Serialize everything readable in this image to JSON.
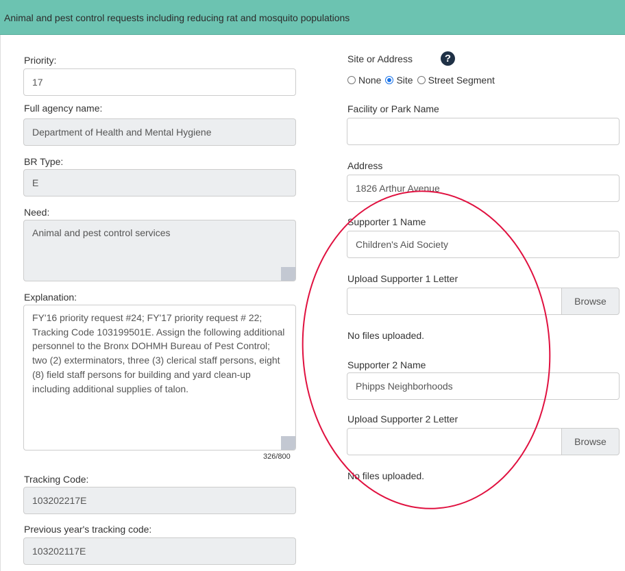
{
  "header": {
    "title": "Animal and pest control requests including reducing rat and mosquito populations"
  },
  "left": {
    "priority": {
      "label": "Priority:",
      "value": "17"
    },
    "agency": {
      "label": "Full agency name:",
      "value": "Department of Health and Mental Hygiene"
    },
    "br_type": {
      "label": "BR Type:",
      "value": "E"
    },
    "need": {
      "label": "Need:",
      "value": "Animal and pest control services"
    },
    "explanation": {
      "label": "Explanation:",
      "value": "FY'16 priority request #24; FY'17 priority request # 22; Tracking Code 103199501E.  Assign the following additional personnel to the Bronx DOHMH Bureau of Pest Control; two (2) exterminators, three (3) clerical staff persons, eight (8) field staff persons for building and yard clean-up including additional supplies of talon.",
      "counter": "326/800"
    },
    "tracking_code": {
      "label": "Tracking Code:",
      "value": "103202217E"
    },
    "prev_tracking": {
      "label": "Previous year's tracking code:",
      "value": "103202117E"
    }
  },
  "right": {
    "site_address": {
      "label": "Site or Address",
      "help_icon": "?",
      "options": [
        "None",
        "Site",
        "Street Segment"
      ],
      "selected": "Site"
    },
    "facility": {
      "label": "Facility or Park Name",
      "value": ""
    },
    "address": {
      "label": "Address",
      "value": "1826 Arthur Avenue"
    },
    "supporter1": {
      "label": "Supporter 1 Name",
      "value": "Children's Aid Society"
    },
    "upload1": {
      "label": "Upload Supporter 1 Letter",
      "button": "Browse",
      "status": "No files uploaded."
    },
    "supporter2": {
      "label": "Supporter 2 Name",
      "value": "Phipps Neighborhoods"
    },
    "upload2": {
      "label": "Upload Supporter 2 Letter",
      "button": "Browse",
      "status": "No files uploaded."
    }
  },
  "colors": {
    "header": "#6cc3b1",
    "annotation": "#e0103f",
    "readonly": "#eceef0"
  }
}
